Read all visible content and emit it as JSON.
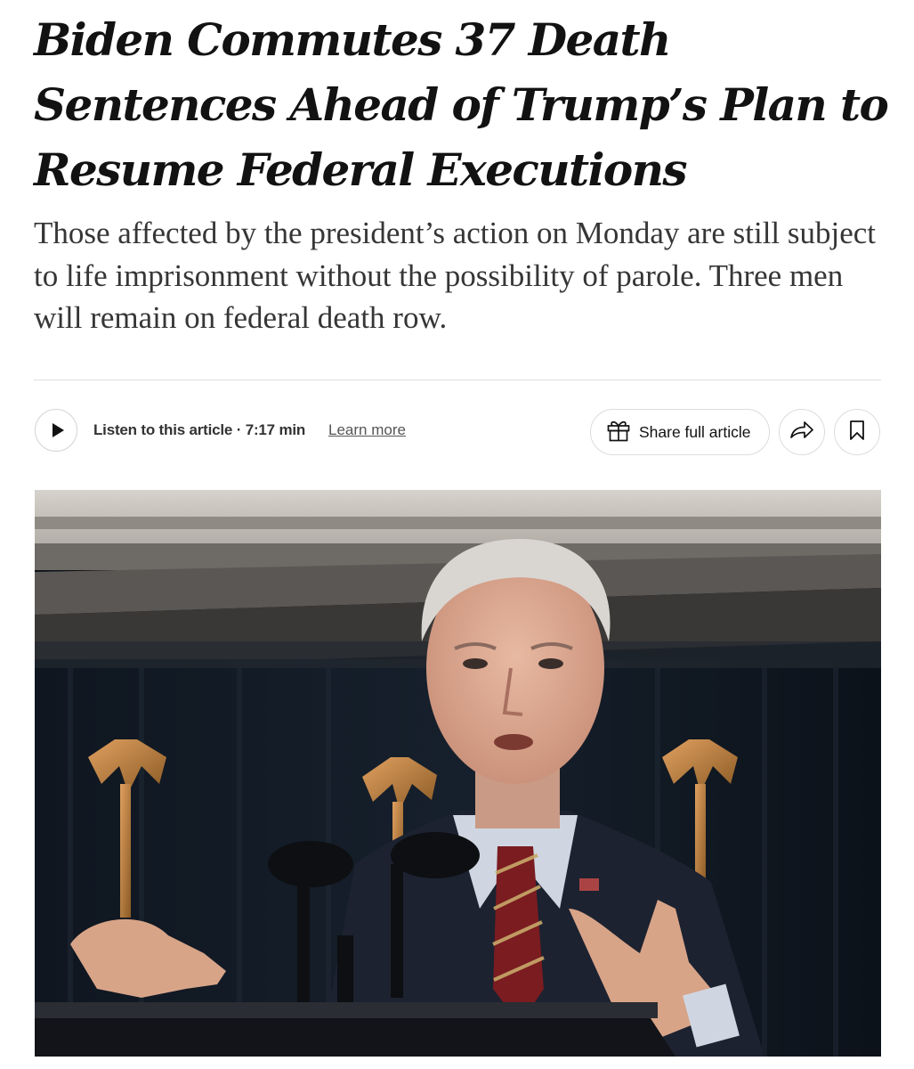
{
  "article": {
    "headline": "Biden Commutes 37 Death Sentences Ahead of Trump’s Plan to Resume Federal Executions",
    "dek": "Those affected by the president’s action on Monday are still subject to life imprisonment without the possibility of parole. Three men will remain on federal death row."
  },
  "audio": {
    "label": "Listen to this article · 7:17 min",
    "learn_more": "Learn more"
  },
  "toolbar": {
    "share_full_label": "Share full article",
    "icons": {
      "play": "play-icon",
      "gift": "gift-icon",
      "share": "share-arrow-icon",
      "bookmark": "bookmark-icon"
    }
  },
  "photo": {
    "subject": "man in dark suit with striped red tie speaking at podium with microphones, gold eagle finials in background"
  }
}
